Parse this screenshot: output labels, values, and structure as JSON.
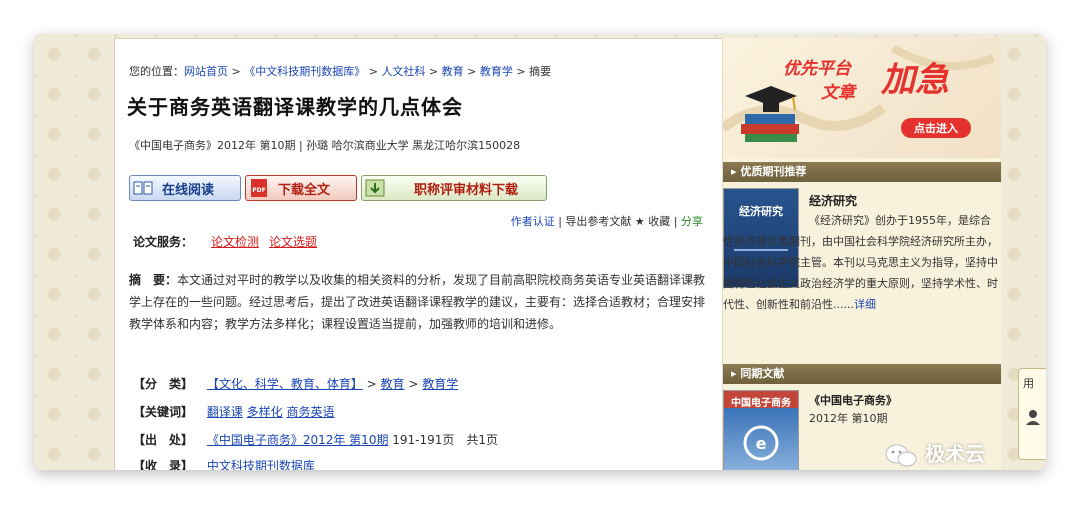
{
  "breadcrumb": {
    "prefix": "您的位置：",
    "items": [
      "网站首页",
      "《中文科技期刊数据库》",
      "人文社科",
      "教育",
      "教育学"
    ],
    "current": "摘要",
    "sep": " > "
  },
  "article": {
    "title": "关于商务英语翻译课教学的几点体会",
    "meta": "《中国电子商务》2012年 第10期 | 孙璐   哈尔滨商业大学 黑龙江哈尔滨150028"
  },
  "buttons": {
    "read_online": "在线阅读",
    "download": "下载全文",
    "title_material": "职称评审材料下载",
    "pdf_tag": "PDF"
  },
  "tools": {
    "author_cert": "作者认证",
    "export_ref": "导出参考文献",
    "favorite": "★ 收藏",
    "share": "分享",
    "sep": "|"
  },
  "services": {
    "label": "论文服务：",
    "check": "论文检测",
    "topic": "论文选题"
  },
  "abstract": {
    "label": "摘　要：",
    "text": "本文通过对平时的教学以及收集的相关资料的分析，发现了目前高职院校商务英语专业英语翻译课教学上存在的一些问题。经过思考后，提出了改进英语翻译课程教学的建议，主要有：选择合适教材；合理安排教学体系和内容；教学方法多样化；课程设置适当提前，加强教师的培训和进修。"
  },
  "fields": {
    "category_label": "【分　类】",
    "category_links": [
      "【文化、科学、教育、体育】",
      "教育",
      "教育学"
    ],
    "keywords_label": "【关键词】",
    "keywords": [
      "翻译课",
      "多样化",
      "商务英语"
    ],
    "source_label": "【出　处】",
    "source_link": "《中国电子商务》2012年 第10期",
    "source_pages": "191-191页　共1页",
    "collection_label": "【收　录】",
    "collection_link": "中文科技期刊数据库"
  },
  "sidebar": {
    "banner_line1": "优先平台",
    "banner_line2": "文章",
    "banner_big": "加急",
    "banner_button": "点击进入",
    "recommend_title": "优质期刊推荐",
    "journal_name": "经济研究",
    "journal_cover_text": "经济研究",
    "journal_desc": "《经济研究》创办于1955年，是综合性经济理论类期刊，由中国社会科学院经济研究所主办，中国社会科学院主管。本刊以马克思主义为指导，坚持中国特色社会主义政治经济学的重大原则，坚持学术性、时代性、创新性和前沿性......",
    "detail_link": "详细",
    "same_issue_title": "同期文献",
    "same_issue_journal": "《中国电子商务》",
    "same_issue_issue": "2012年 第10期",
    "same_issue_cover_text": "中国电子商务"
  },
  "floating_tab": "用",
  "watermark": "极术云",
  "colors": {
    "link": "#1b46b5",
    "red_link": "#d41c1c",
    "section_bar": "#7a6a44",
    "banner_red": "#e5322d"
  }
}
